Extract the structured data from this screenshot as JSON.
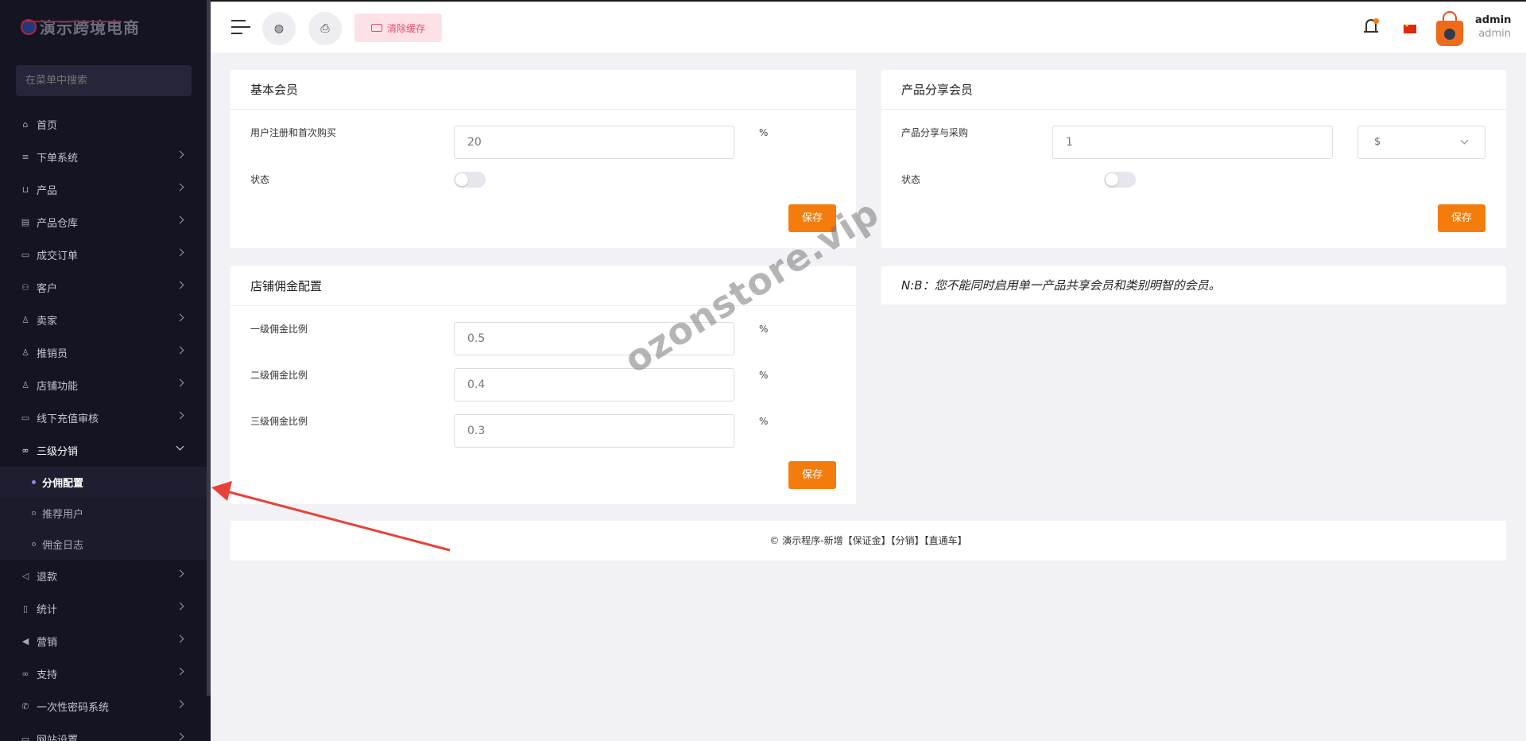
{
  "sidebar": {
    "logo_text": "演示跨境电商",
    "search_placeholder": "在菜单中搜索",
    "items": [
      {
        "label": "首页",
        "icon": "home-icon",
        "glyph": "⌂",
        "chevron": false
      },
      {
        "label": "下单系统",
        "icon": "list-icon",
        "glyph": "≡",
        "chevron": true
      },
      {
        "label": "产品",
        "icon": "cart-icon",
        "glyph": "⊔",
        "chevron": true
      },
      {
        "label": "产品仓库",
        "icon": "archive-icon",
        "glyph": "▤",
        "chevron": true
      },
      {
        "label": "成交订单",
        "icon": "ticket-icon",
        "glyph": "▭",
        "chevron": true
      },
      {
        "label": "客户",
        "icon": "users-icon",
        "glyph": "⚇",
        "chevron": true
      },
      {
        "label": "卖家",
        "icon": "user-icon",
        "glyph": "♙",
        "chevron": true
      },
      {
        "label": "推销员",
        "icon": "user-icon",
        "glyph": "♙",
        "chevron": true
      },
      {
        "label": "店铺功能",
        "icon": "user-icon",
        "glyph": "♙",
        "chevron": true
      },
      {
        "label": "线下充值审核",
        "icon": "card-icon",
        "glyph": "▭",
        "chevron": true
      }
    ],
    "open_item": {
      "label": "三级分销",
      "icon": "link-icon",
      "glyph": "∞"
    },
    "sub_items": [
      {
        "label": "分佣配置",
        "active": true
      },
      {
        "label": "推荐用户",
        "active": false
      },
      {
        "label": "佣金日志",
        "active": false
      }
    ],
    "items_after": [
      {
        "label": "退款",
        "icon": "rewind-icon",
        "glyph": "◁"
      },
      {
        "label": "统计",
        "icon": "file-icon",
        "glyph": "▯"
      },
      {
        "label": "营销",
        "icon": "megaphone-icon",
        "glyph": "◀"
      },
      {
        "label": "支持",
        "icon": "link-icon",
        "glyph": "∞"
      },
      {
        "label": "一次性密码系统",
        "icon": "phone-icon",
        "glyph": "✆"
      },
      {
        "label": "网站设置",
        "icon": "settings-icon",
        "glyph": "▭"
      }
    ]
  },
  "header": {
    "clear_cache_label": "清除缓存",
    "user_name": "admin",
    "user_role": "admin"
  },
  "basic_member": {
    "title": "基本会员",
    "reg_label": "用户注册和首次购买",
    "reg_value": "20",
    "unit": "%",
    "status_label": "状态",
    "save_label": "保存"
  },
  "product_share": {
    "title": "产品分享会员",
    "share_label": "产品分享与采购",
    "share_value": "1",
    "currency": "$",
    "status_label": "状态",
    "save_label": "保存"
  },
  "store_commission": {
    "title": "店铺佣金配置",
    "levels": [
      {
        "label": "一级佣金比例",
        "value": "0.5"
      },
      {
        "label": "二级佣金比例",
        "value": "0.4"
      },
      {
        "label": "三级佣金比例",
        "value": "0.3"
      }
    ],
    "unit": "%",
    "save_label": "保存"
  },
  "note": "N:B：您不能同时启用单一产品共享会员和类别明智的会员。",
  "footer": "© 演示程序-新增【保证金】【分销】【直通车】",
  "watermark": "ozonstore.vip",
  "colors": {
    "sidebar_bg": "#141422",
    "accent_orange": "#f47c0c",
    "clear_btn_bg": "#fde1e6",
    "annotation_arrow": "#e8413a"
  }
}
